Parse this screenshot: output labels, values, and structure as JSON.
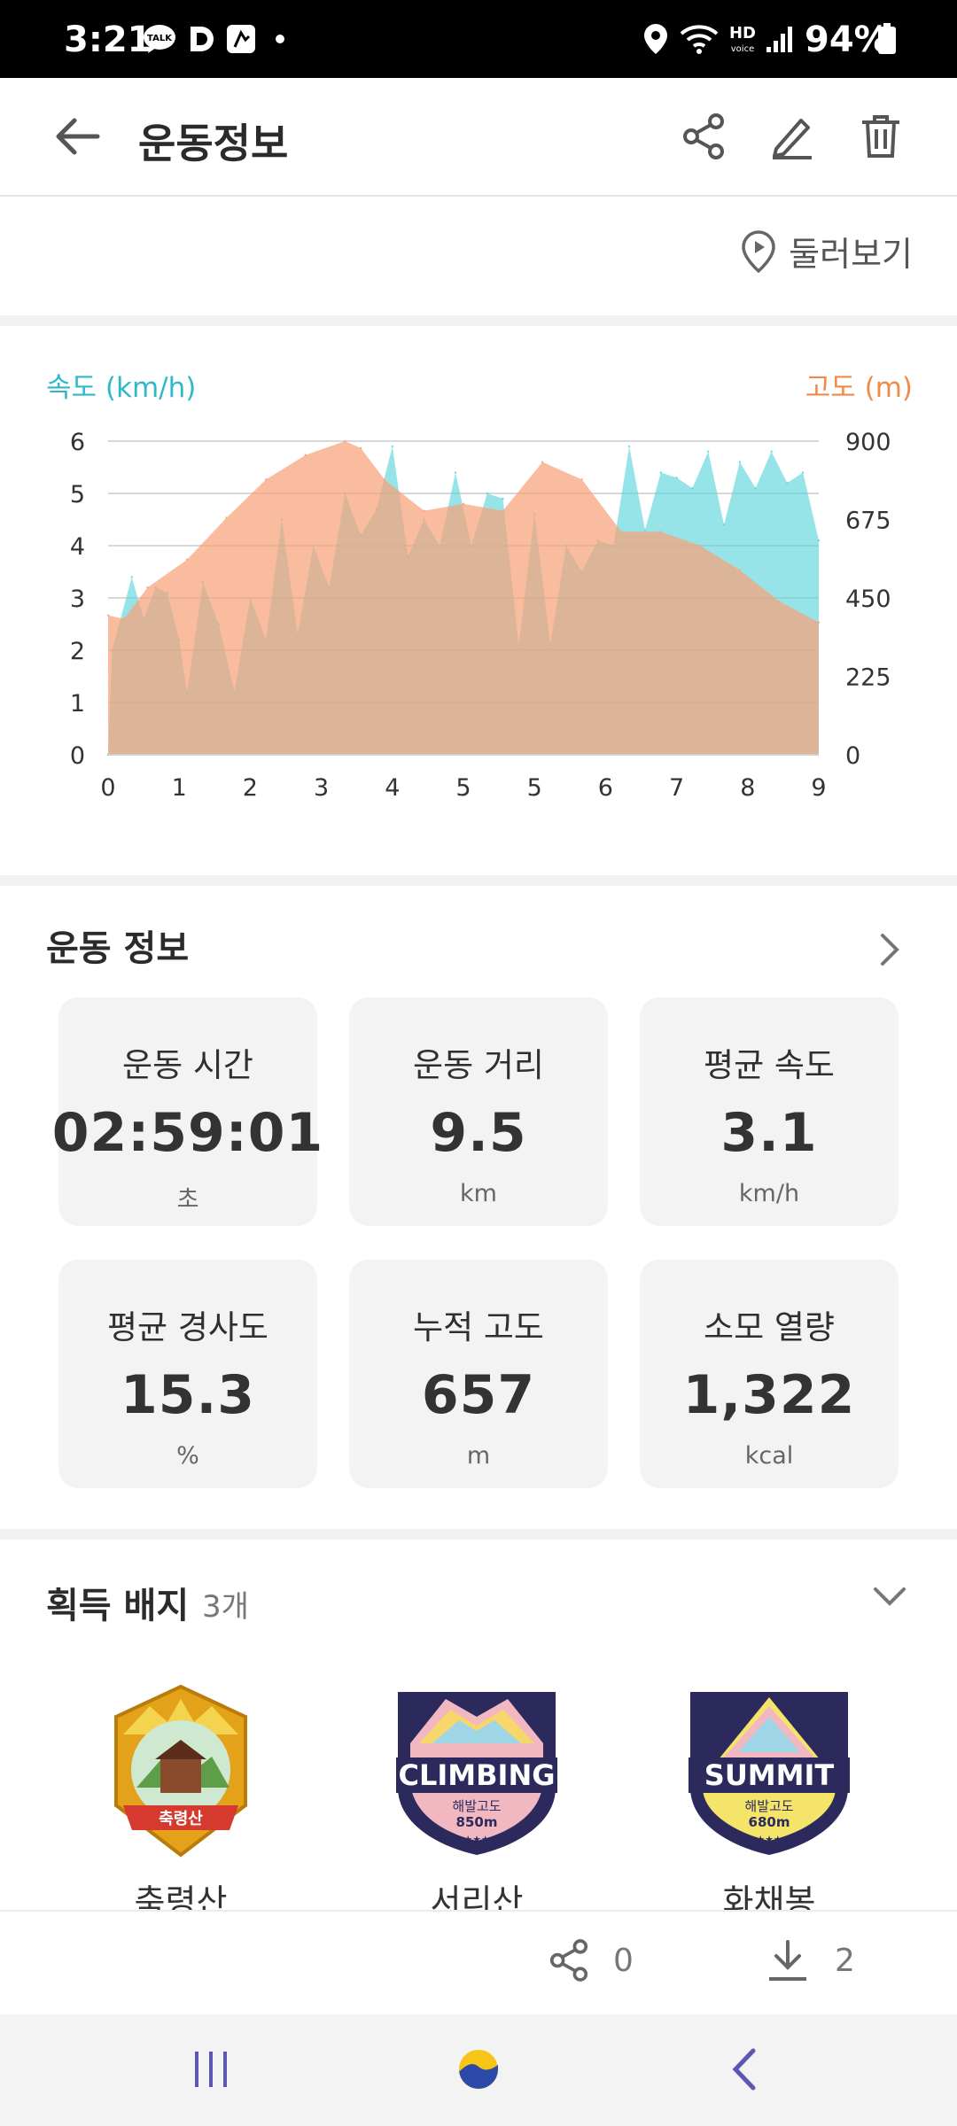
{
  "status_bar": {
    "time": "3:21",
    "battery": "94%",
    "notification_icons": [
      "talk-icon",
      "d-icon",
      "r-icon",
      "dot-icon"
    ],
    "system_icons": [
      "location-icon",
      "wifi-icon",
      "hd-voice-icon",
      "signal-icon",
      "battery-icon"
    ]
  },
  "app_bar": {
    "title": "운동정보",
    "actions": [
      "share-icon",
      "edit-icon",
      "delete-icon"
    ]
  },
  "map_section": {
    "lookaround_label": "둘러보기"
  },
  "chart_data": {
    "type": "area",
    "xlim": [
      0,
      9
    ],
    "x_ticks": [
      "0",
      "1",
      "2",
      "3",
      "4",
      "5",
      "5",
      "6",
      "7",
      "8",
      "9"
    ],
    "y_left": {
      "label": "속도 (km/h)",
      "ticks": [
        "0",
        "1",
        "2",
        "3",
        "4",
        "5",
        "6"
      ],
      "ylim": [
        0,
        6
      ]
    },
    "y_right": {
      "label": "고도 (m)",
      "ticks": [
        "0",
        "225",
        "450",
        "675",
        "900"
      ],
      "ylim": [
        0,
        900
      ]
    },
    "grid": true,
    "series": [
      {
        "axis": "right",
        "color": "#f6a27a",
        "x": [
          0,
          0.2,
          0.5,
          1.0,
          1.5,
          2.0,
          2.5,
          3.0,
          3.2,
          3.5,
          4.0,
          4.5,
          5.0,
          5.5,
          6.0,
          6.5,
          7.0,
          7.5,
          8.0,
          8.5,
          9.0
        ],
        "values": [
          400,
          390,
          480,
          560,
          680,
          790,
          860,
          900,
          880,
          790,
          700,
          720,
          700,
          840,
          790,
          640,
          640,
          600,
          530,
          440,
          380
        ]
      },
      {
        "axis": "left",
        "color": "#5fd6db",
        "x": [
          0,
          0.05,
          0.3,
          0.45,
          0.6,
          0.75,
          0.9,
          1.0,
          1.2,
          1.4,
          1.6,
          1.8,
          2.0,
          2.2,
          2.4,
          2.6,
          2.8,
          3.0,
          3.2,
          3.4,
          3.6,
          3.8,
          4.0,
          4.2,
          4.4,
          4.6,
          4.8,
          5.0,
          5.2,
          5.4,
          5.6,
          5.8,
          6.0,
          6.2,
          6.4,
          6.6,
          6.8,
          7.0,
          7.2,
          7.4,
          7.6,
          7.8,
          8.0,
          8.2,
          8.4,
          8.6,
          8.8,
          9.0
        ],
        "values": [
          0,
          2.0,
          3.4,
          2.6,
          3.2,
          3.1,
          2.2,
          1.2,
          3.3,
          2.5,
          1.2,
          3.0,
          2.2,
          4.5,
          2.3,
          4.0,
          3.2,
          5.0,
          4.2,
          4.7,
          5.9,
          3.8,
          4.5,
          4.0,
          5.4,
          4.0,
          5.0,
          4.9,
          2.1,
          4.6,
          2.1,
          4.0,
          3.5,
          4.1,
          4.0,
          5.9,
          4.3,
          5.4,
          5.3,
          5.1,
          5.8,
          4.4,
          5.6,
          5.1,
          5.8,
          5.2,
          5.4,
          4.1
        ]
      }
    ]
  },
  "info": {
    "title": "운동 정보",
    "cards": [
      {
        "label": "운동 시간",
        "value": "02:59:01",
        "unit": "초"
      },
      {
        "label": "운동 거리",
        "value": "9.5",
        "unit": "km"
      },
      {
        "label": "평균 속도",
        "value": "3.1",
        "unit": "km/h"
      },
      {
        "label": "평균 경사도",
        "value": "15.3",
        "unit": "%"
      },
      {
        "label": "누적 고도",
        "value": "657",
        "unit": "m"
      },
      {
        "label": "소모 열량",
        "value": "1,322",
        "unit": "kcal"
      }
    ]
  },
  "badges": {
    "title": "획득 배지",
    "count": "3개",
    "items": [
      {
        "name": "축령산",
        "emblem_text": "축령산"
      },
      {
        "name": "서리산",
        "emblem_text": "CLIMBING",
        "sub": "해발고도",
        "alt": "850m"
      },
      {
        "name": "화채봉",
        "emblem_text": "SUMMIT",
        "sub": "해발고도",
        "alt": "680m"
      }
    ]
  },
  "footer": {
    "share_count": "0",
    "download_count": "2"
  },
  "colors": {
    "speed": "#2fb9c8",
    "altitude": "#f08a4b"
  }
}
